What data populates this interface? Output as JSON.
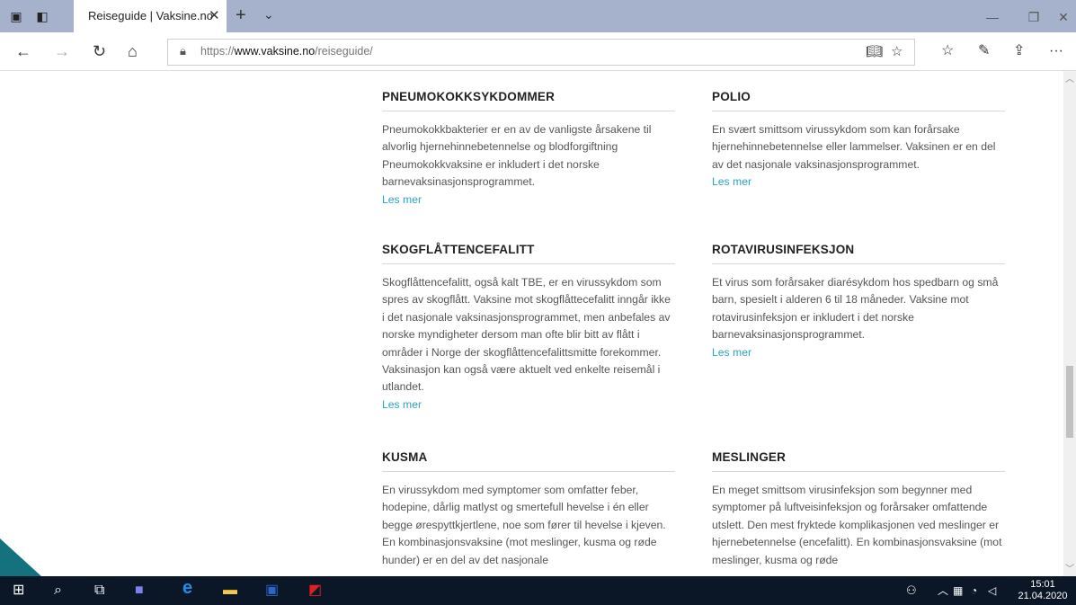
{
  "browser": {
    "tab_title": "Reiseguide | Vaksine.no",
    "url_prefix": "https://",
    "url_domain": "www.vaksine.no",
    "url_path": "/reiseguide/"
  },
  "sections": [
    {
      "title": "PNEUMOKOKKSYKDOMMER",
      "body": "Pneumokokkbakterier er en av de vanligste årsakene til alvorlig hjernehinnebetennelse og blodforgiftning Pneumokokkvaksine er inkludert i det norske barnevaksinasjonsprogrammet.",
      "link": "Les mer"
    },
    {
      "title": "POLIO",
      "body": "En svært smittsom virussykdom som kan forårsake hjernehinnebetennelse eller lammelser. Vaksinen er en del av det nasjonale vaksinasjonsprogrammet.",
      "link": "Les mer"
    },
    {
      "title": "SKOGFLÅTTENCEFALITT",
      "body": "Skogflåttencefalitt, også kalt TBE, er en virussykdom som spres av skogflått. Vaksine mot skogflåttecefalitt inngår ikke i det nasjonale vaksinasjonsprogrammet, men anbefales av norske myndigheter dersom man ofte blir bitt av flått i områder i Norge der skogflåttencefalittsmitte forekommer. Vaksinasjon kan også være aktuelt ved enkelte reisemål i utlandet.",
      "link": "Les mer"
    },
    {
      "title": "ROTAVIRUSINFEKSJON",
      "body": "Et virus som forårsaker diarésykdom hos spedbarn og små barn, spesielt i alderen 6 til 18 måneder. Vaksine mot rotavirusinfeksjon er inkludert i det norske barnevaksinasjonsprogrammet.",
      "link": "Les mer"
    },
    {
      "title": "KUSMA",
      "body": "En virussykdom med symptomer som omfatter feber, hodepine, dårlig matlyst og smertefull hevelse i én eller begge ørespyttkjertlene, noe som fører til hevelse i kjeven. En kombinasjonsvaksine (mot meslinger, kusma og røde hunder) er en del av det nasjonale",
      "link": ""
    },
    {
      "title": "MESLINGER",
      "body": "En meget smittsom virusinfeksjon som begynner med symptomer på luftveisinfeksjon og forårsaker omfattende utslett. Den mest fryktede komplikasjonen ved meslinger er hjernebetennelse (encefalitt). En kombinasjonsvaksine (mot meslinger, kusma og røde",
      "link": ""
    }
  ],
  "taskbar": {
    "time": "15:01",
    "date": "21.04.2020"
  }
}
